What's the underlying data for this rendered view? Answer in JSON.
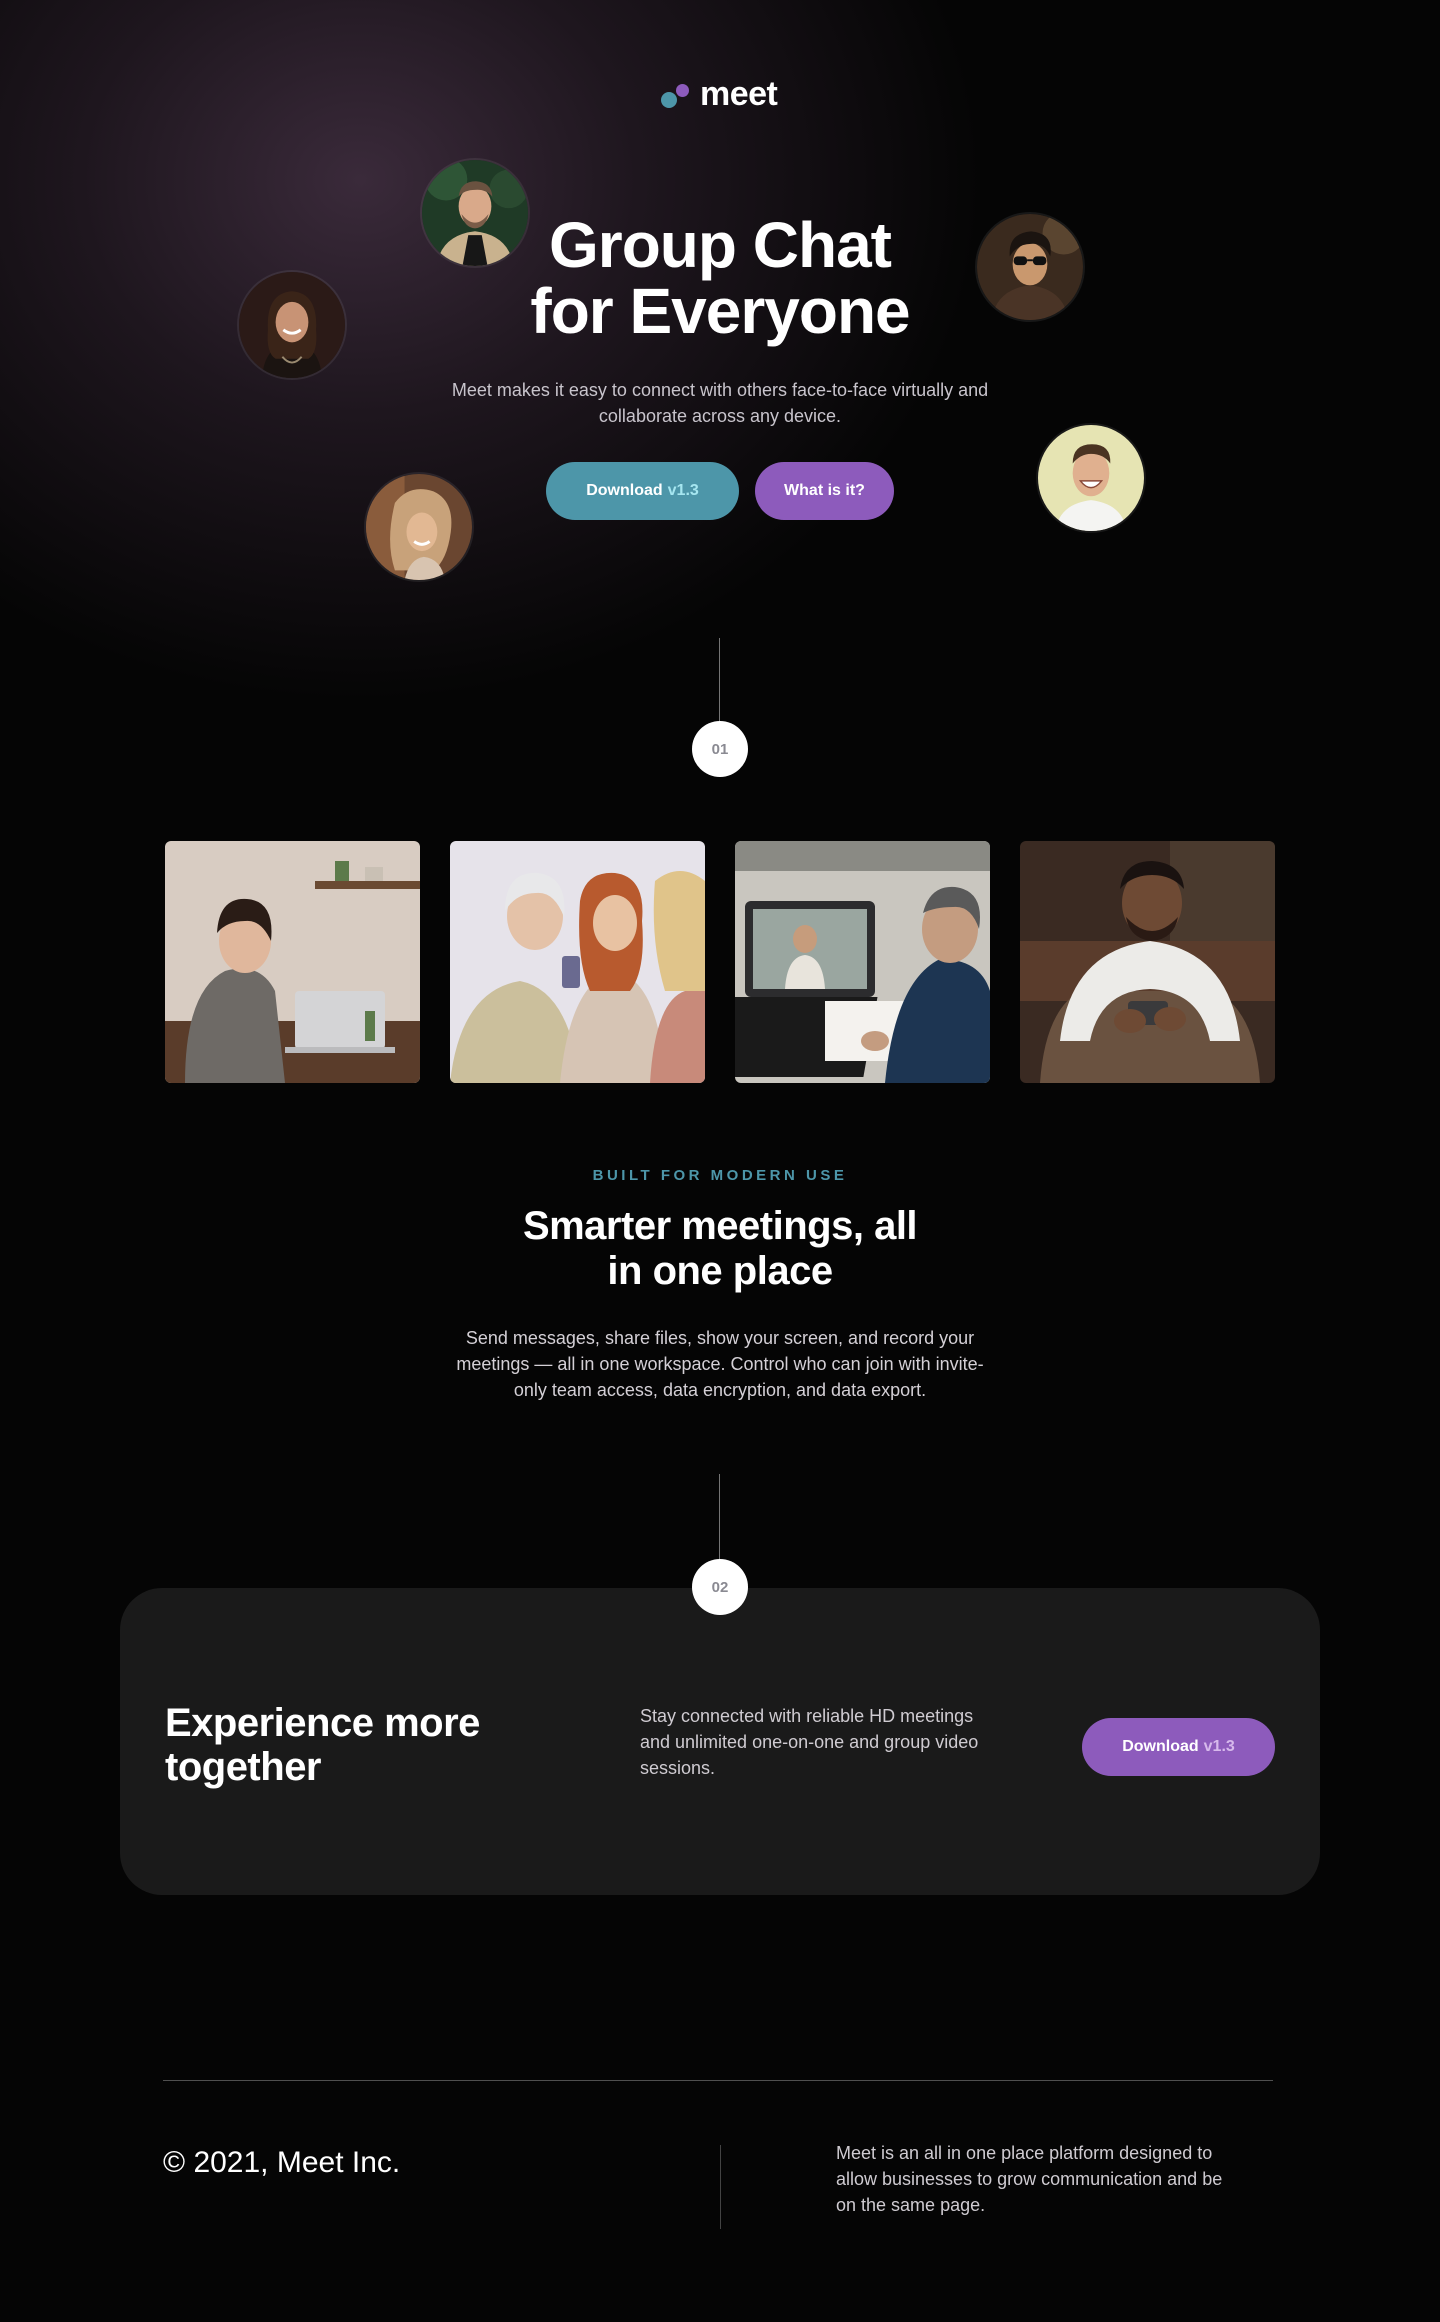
{
  "brand": {
    "name": "meet",
    "teal": "#4d96a9",
    "purple": "#8d5bbc"
  },
  "hero": {
    "title_line1": "Group Chat",
    "title_line2": "for Everyone",
    "subtitle": "Meet makes it easy to connect with others face-to-face virtually and collaborate across any device.",
    "download_label": "Download",
    "download_version": "v1.3",
    "what_label": "What is it?"
  },
  "avatars": [
    "man-with-beard-avatar",
    "smiling-woman-avatar",
    "man-with-sunglasses-avatar",
    "laughing-man-avatar",
    "woman-smiling-avatar"
  ],
  "steps": {
    "first": "01",
    "second": "02"
  },
  "photos": [
    "woman-laptop-kitchen-photo",
    "women-phone-photo",
    "video-call-photo",
    "man-phone-photo"
  ],
  "features": {
    "eyebrow": "BUILT FOR MODERN USE",
    "title_line1": "Smarter meetings, all",
    "title_line2": "in one place",
    "body": "Send messages, share files, show your screen, and record your meetings — all in one workspace. Control who can join with invite-only team access, data encryption, and data export."
  },
  "cta": {
    "title_line1": "Experience more",
    "title_line2": "together",
    "body": "Stay connected with reliable HD meetings and unlimited one-on-one and group video sessions.",
    "download_label": "Download",
    "download_version": "v1.3"
  },
  "footer": {
    "copyright": "© 2021, Meet Inc.",
    "description": "Meet is an all in one place platform designed to allow businesses to grow communication and be on the same page."
  }
}
